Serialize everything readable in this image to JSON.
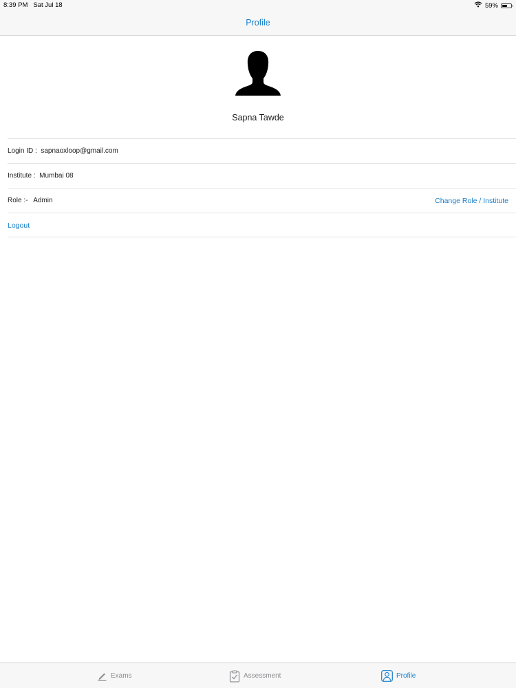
{
  "status_bar": {
    "time": "8:39 PM",
    "date": "Sat Jul 18",
    "battery_percent": "59%",
    "battery_level": 0.59
  },
  "nav": {
    "title": "Profile"
  },
  "profile": {
    "name": "Sapna Tawde"
  },
  "info": {
    "login_id": "Login ID :  sapnaoxloop@gmail.com",
    "institute": "Institute :  Mumbai 08",
    "role": "Role :-   Admin",
    "change_role_label": "Change Role / Institute",
    "logout_label": "Logout"
  },
  "tabs": [
    {
      "label": "Exams",
      "icon": "pencil-icon",
      "active": false
    },
    {
      "label": "Assessment",
      "icon": "clipboard-check-icon",
      "active": false
    },
    {
      "label": "Profile",
      "icon": "person-icon",
      "active": true
    }
  ],
  "colors": {
    "accent": "#1a7fc9",
    "inactive_tab": "#8e8e93",
    "bar_background": "#f7f7f7"
  }
}
